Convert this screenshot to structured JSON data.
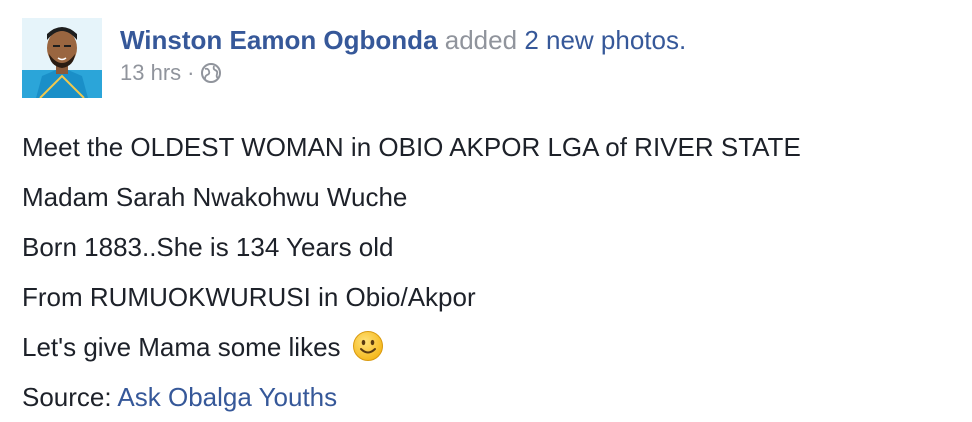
{
  "post": {
    "author": "Winston Eamon Ogbonda",
    "action_verb": "added",
    "action_object": "2 new photos.",
    "timestamp": "13 hrs",
    "separator": "·",
    "privacy_icon": "globe-icon",
    "lines": [
      "Meet the OLDEST WOMAN in OBIO AKPOR LGA of RIVER STATE",
      "Madam Sarah Nwakohwu Wuche",
      "Born 1883..She is 134 Years old",
      "From RUMUOKWURUSI in Obio/Akpor",
      "Let's give Mama some likes"
    ],
    "emoji_icon": "smiley-icon",
    "source_label": "Source:",
    "source_link": "Ask Obalga Youths"
  },
  "colors": {
    "link": "#365899",
    "muted": "#90949c",
    "text": "#1d2129",
    "background": "#ffffff"
  }
}
